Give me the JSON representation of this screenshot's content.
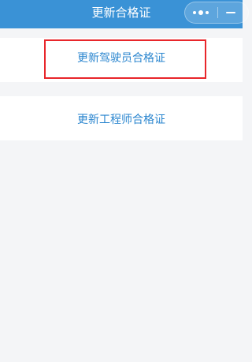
{
  "navbar": {
    "title": "更新合格证",
    "background": "#3a92d6"
  },
  "capsule": {
    "more_icon": "more-dots-icon",
    "minimize_icon": "minimize-icon"
  },
  "options": [
    {
      "label": "更新驾驶员合格证",
      "highlighted": true
    },
    {
      "label": "更新工程师合格证",
      "highlighted": false
    }
  ],
  "colors": {
    "link_text": "#2b86cf",
    "highlight_border": "#e8262b",
    "page_bg": "#f4f5f7"
  }
}
